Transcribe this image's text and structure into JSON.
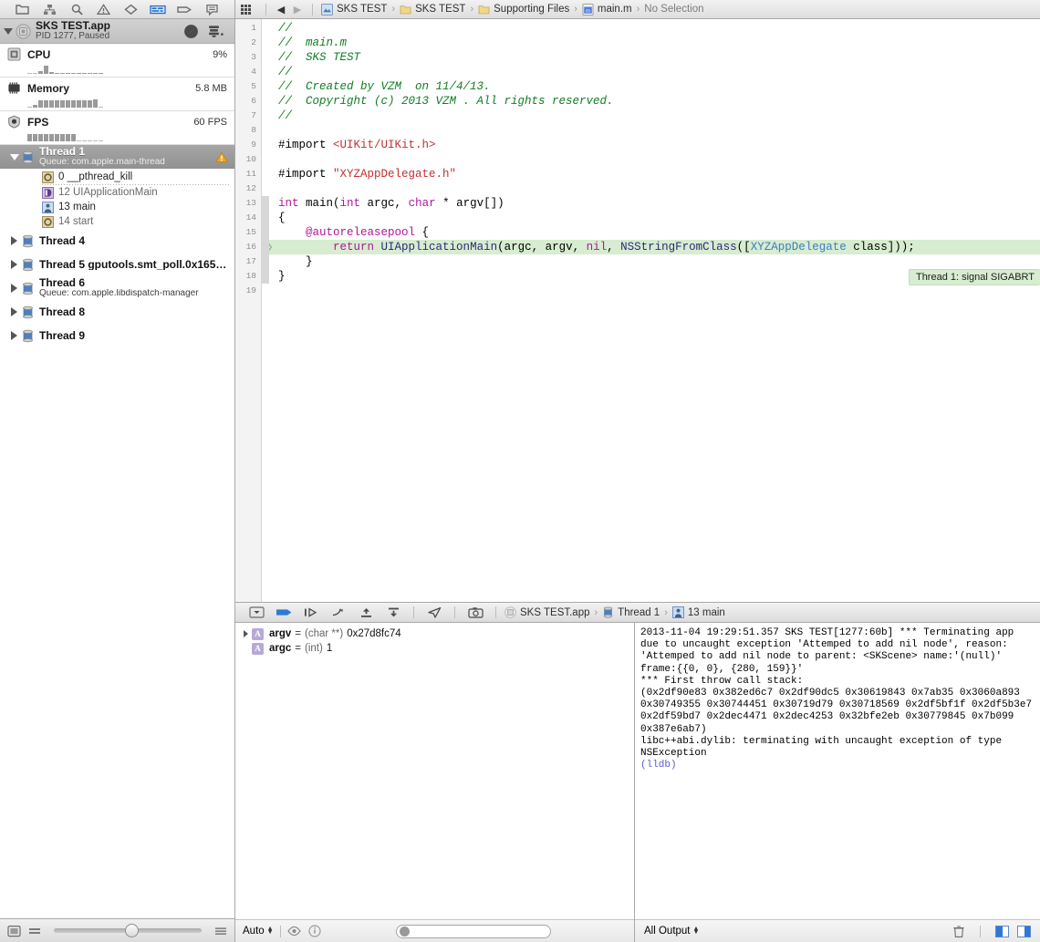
{
  "navigator": {
    "toolbar_icons": [
      "folder-icon",
      "source-control-icon",
      "search-icon",
      "warning-triangle-icon",
      "breakpoint-icon",
      "debug-navigator-icon",
      "log-tag-icon",
      "report-icon"
    ],
    "process": {
      "name": "SKS TEST.app",
      "status": "PID 1277, Paused",
      "gauge_button": "gauge-icon",
      "filter_button": "process-filter-icon"
    },
    "gauges": [
      {
        "label": "CPU",
        "value": "9%",
        "icon": "cpu-icon",
        "bars": [
          0,
          0,
          3,
          9,
          2,
          1,
          1,
          1,
          1,
          1,
          1,
          1,
          1,
          1
        ]
      },
      {
        "label": "Memory",
        "value": "5.8 MB",
        "icon": "memory-icon",
        "bars": [
          0,
          3,
          8,
          8,
          8,
          8,
          8,
          8,
          8,
          8,
          8,
          8,
          9,
          0
        ]
      },
      {
        "label": "FPS",
        "value": "60 FPS",
        "icon": "fps-icon",
        "bars": [
          8,
          8,
          8,
          8,
          8,
          8,
          8,
          8,
          8,
          0,
          0,
          0,
          0,
          0
        ]
      }
    ],
    "threads": [
      {
        "title": "Thread 1",
        "subtitle": "Queue: com.apple.main-thread",
        "selected": true,
        "expanded": true,
        "warning": true,
        "frames": [
          {
            "label": "0 __pthread_kill",
            "icon": "frame-system-icon",
            "dim": false,
            "separator": true
          },
          {
            "label": "12 UIApplicationMain",
            "icon": "frame-framework-icon",
            "dim": true,
            "separator": false
          },
          {
            "label": "13 main",
            "icon": "frame-user-icon",
            "dim": false,
            "separator": false
          },
          {
            "label": "14 start",
            "icon": "frame-system-icon",
            "dim": true,
            "separator": false
          }
        ]
      },
      {
        "title": "Thread 4",
        "subtitle": "",
        "selected": false,
        "expanded": false,
        "warning": false,
        "frames": []
      },
      {
        "title": "Thread 5 gputools.smt_poll.0x165…",
        "subtitle": "",
        "selected": false,
        "expanded": false,
        "warning": false,
        "frames": []
      },
      {
        "title": "Thread 6",
        "subtitle": "Queue: com.apple.libdispatch-manager",
        "selected": false,
        "expanded": false,
        "warning": false,
        "frames": []
      },
      {
        "title": "Thread 8",
        "subtitle": "",
        "selected": false,
        "expanded": false,
        "warning": false,
        "frames": []
      },
      {
        "title": "Thread 9",
        "subtitle": "",
        "selected": false,
        "expanded": false,
        "warning": false,
        "frames": []
      }
    ],
    "footer": {
      "left_icon": "filter-view-icon",
      "list_icon": "list-style-icon",
      "right_icon": "options-icon",
      "slider_value": 48
    }
  },
  "jumpbar": {
    "grid_icon": "related-items-icon",
    "back_label": "◀",
    "forward_label": "▶",
    "crumbs": [
      {
        "label": "SKS TEST",
        "icon": "project-icon",
        "dim": false
      },
      {
        "label": "SKS TEST",
        "icon": "folder-icon",
        "dim": false
      },
      {
        "label": "Supporting Files",
        "icon": "folder-icon",
        "dim": false
      },
      {
        "label": "main.m",
        "icon": "objc-file-icon",
        "dim": false
      },
      {
        "label": "No Selection",
        "icon": "",
        "dim": true
      }
    ]
  },
  "editor": {
    "line_count": 19,
    "highlighted_line": 16,
    "annotation": "Thread 1: signal SIGABRT",
    "lines": [
      {
        "n": 1,
        "segs": [
          {
            "t": "//",
            "c": "tok-c"
          }
        ]
      },
      {
        "n": 2,
        "segs": [
          {
            "t": "//  main.m",
            "c": "tok-c"
          }
        ]
      },
      {
        "n": 3,
        "segs": [
          {
            "t": "//  SKS TEST",
            "c": "tok-c"
          }
        ]
      },
      {
        "n": 4,
        "segs": [
          {
            "t": "//",
            "c": "tok-c"
          }
        ]
      },
      {
        "n": 5,
        "segs": [
          {
            "t": "//  Created by VZM  on 11/4/13.",
            "c": "tok-c"
          }
        ]
      },
      {
        "n": 6,
        "segs": [
          {
            "t": "//  Copyright (c) 2013 VZM . All rights reserved.",
            "c": "tok-c"
          }
        ]
      },
      {
        "n": 7,
        "segs": [
          {
            "t": "//",
            "c": "tok-c"
          }
        ]
      },
      {
        "n": 8,
        "segs": []
      },
      {
        "n": 9,
        "segs": [
          {
            "t": "#import ",
            "c": "tok-pp"
          },
          {
            "t": "<UIKit/UIKit.h>",
            "c": "tok-str"
          }
        ]
      },
      {
        "n": 10,
        "segs": []
      },
      {
        "n": 11,
        "segs": [
          {
            "t": "#import ",
            "c": "tok-pp"
          },
          {
            "t": "\"XYZAppDelegate.h\"",
            "c": "tok-str"
          }
        ]
      },
      {
        "n": 12,
        "segs": []
      },
      {
        "n": 13,
        "segs": [
          {
            "t": "int",
            "c": "tok-kw"
          },
          {
            "t": " main(",
            "c": "tok-pp"
          },
          {
            "t": "int",
            "c": "tok-kw"
          },
          {
            "t": " argc, ",
            "c": "tok-pp"
          },
          {
            "t": "char",
            "c": "tok-kw"
          },
          {
            "t": " * argv[])",
            "c": "tok-pp"
          }
        ]
      },
      {
        "n": 14,
        "segs": [
          {
            "t": "{",
            "c": "tok-pp"
          }
        ]
      },
      {
        "n": 15,
        "segs": [
          {
            "t": "    ",
            "c": "tok-pp"
          },
          {
            "t": "@autoreleasepool",
            "c": "tok-kw"
          },
          {
            "t": " {",
            "c": "tok-pp"
          }
        ]
      },
      {
        "n": 16,
        "segs": [
          {
            "t": "        ",
            "c": "tok-pp"
          },
          {
            "t": "return",
            "c": "tok-kw"
          },
          {
            "t": " ",
            "c": "tok-pp"
          },
          {
            "t": "UIApplicationMain",
            "c": "tok-fn"
          },
          {
            "t": "(argc, argv, ",
            "c": "tok-pp"
          },
          {
            "t": "nil",
            "c": "tok-kw"
          },
          {
            "t": ", ",
            "c": "tok-pp"
          },
          {
            "t": "NSStringFromClass",
            "c": "tok-fn"
          },
          {
            "t": "([",
            "c": "tok-pp"
          },
          {
            "t": "XYZAppDelegate",
            "c": "tok-cls"
          },
          {
            "t": " class]));",
            "c": "tok-pp"
          }
        ]
      },
      {
        "n": 17,
        "segs": [
          {
            "t": "    }",
            "c": "tok-pp"
          }
        ]
      },
      {
        "n": 18,
        "segs": [
          {
            "t": "}",
            "c": "tok-pp"
          }
        ]
      },
      {
        "n": 19,
        "segs": []
      }
    ]
  },
  "debug_bar": {
    "buttons": [
      "hide-debug-area-icon",
      "continue-icon",
      "step-over-icon",
      "step-into-icon",
      "step-out-icon",
      "simulate-location-icon",
      "view-hierarchy-icon"
    ],
    "crumbs": [
      {
        "label": "SKS TEST.app",
        "icon": "process-icon"
      },
      {
        "label": "Thread 1",
        "icon": "thread-icon"
      },
      {
        "label": "13 main",
        "icon": "frame-user-icon"
      }
    ]
  },
  "variables": {
    "rows": [
      {
        "expandable": true,
        "badge": "A",
        "name": "argv",
        "type": "(char **)",
        "value": "0x27d8fc74"
      },
      {
        "expandable": false,
        "badge": "A",
        "name": "argc",
        "type": "(int)",
        "value": "1"
      }
    ],
    "footer": {
      "scope_label": "Auto",
      "eye_icon": "eye-icon",
      "info_icon": "info-icon",
      "search_placeholder": ""
    }
  },
  "console": {
    "output": "2013-11-04 19:29:51.357 SKS TEST[1277:60b] *** Terminating app due to uncaught exception 'Attemped to add nil node', reason: 'Attemped to add nil node to parent: <SKScene> name:'(null)' frame:{{0, 0}, {280, 159}}'\n*** First throw call stack:\n(0x2df90e83 0x382ed6c7 0x2df90dc5 0x30619843 0x7ab35 0x3060a893 0x30749355 0x30744451 0x30719d79 0x30718569 0x2df5bf1f 0x2df5b3e7 0x2df59bd7 0x2dec4471 0x2dec4253 0x32bfe2eb 0x30779845 0x7b099 0x387e6ab7)\nlibc++abi.dylib: terminating with uncaught exception of type NSException\n",
    "prompt": "(lldb)",
    "footer": {
      "filter_label": "All Output",
      "trash_icon": "trash-icon",
      "left_pane_icon": "show-variables-icon",
      "right_pane_icon": "show-console-icon"
    }
  }
}
